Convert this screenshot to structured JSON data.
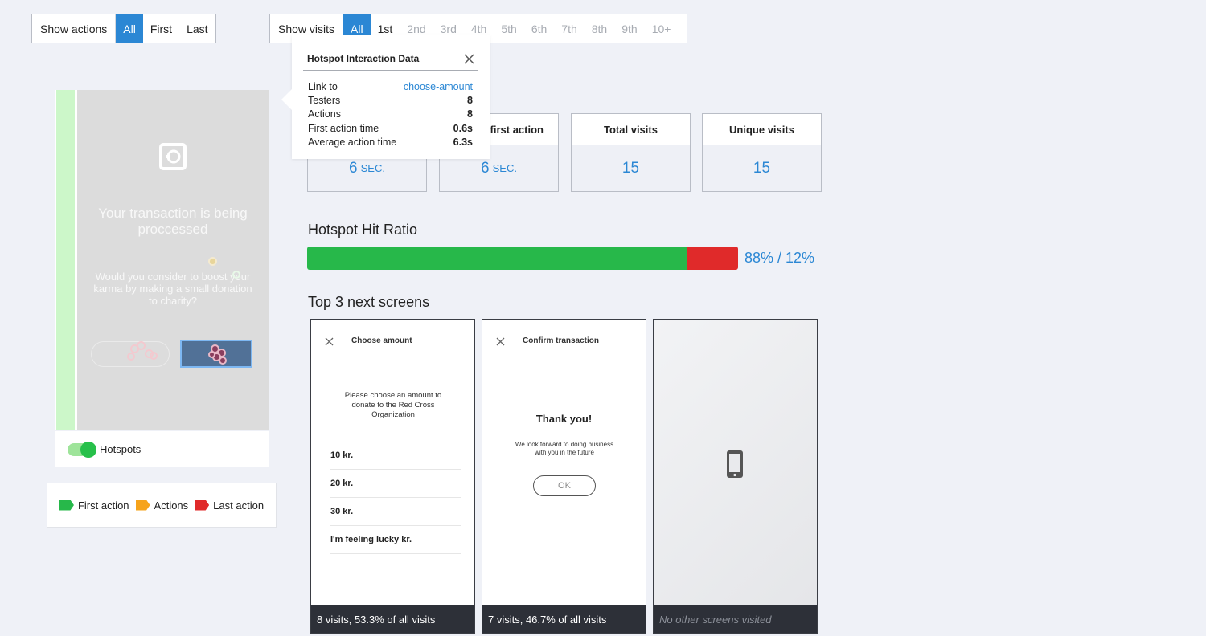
{
  "actions_filter": {
    "label": "Show actions",
    "options": [
      "All",
      "First",
      "Last"
    ],
    "selected": "All"
  },
  "visits_filter": {
    "label": "Show visits",
    "options": [
      "All",
      "1st",
      "2nd",
      "3rd",
      "4th",
      "5th",
      "6th",
      "7th",
      "8th",
      "9th",
      "10+"
    ],
    "selected": "All"
  },
  "screen": {
    "title": "Your transaction is being proccessed",
    "body": "Would you consider to boost your karma by making a small donation to charity?"
  },
  "hotspots_toggle": {
    "label": "Hotspots",
    "on": true
  },
  "legend": {
    "items": [
      {
        "label": "First action",
        "color": "#27b84a"
      },
      {
        "label": "Actions",
        "color": "#f6a31a"
      },
      {
        "label": "Last action",
        "color": "#e02a2a"
      }
    ]
  },
  "popover": {
    "title": "Hotspot Interaction Data",
    "rows": [
      {
        "label": "Link to",
        "value": "choose-amount"
      },
      {
        "label": "Testers",
        "value": "8"
      },
      {
        "label": "Actions",
        "value": "8"
      },
      {
        "label": "First action time",
        "value": "0.6s"
      },
      {
        "label": "Average action time",
        "value": "6.3s"
      }
    ]
  },
  "stats": [
    {
      "header": "",
      "value": "6",
      "unit": "SEC."
    },
    {
      "header": "first action",
      "value": "6",
      "unit": "SEC."
    },
    {
      "header": "Total visits",
      "value": "15",
      "unit": ""
    },
    {
      "header": "Unique visits",
      "value": "15",
      "unit": ""
    }
  ],
  "hit_ratio": {
    "title": "Hotspot Hit Ratio",
    "hit_percent": 88,
    "text": "88% / 12%",
    "hit_color": "#27b84a",
    "miss_color": "#e02a2a"
  },
  "next_screens": {
    "title": "Top 3 next screens",
    "cards": [
      {
        "screen_title": "Choose amount",
        "description": "Please choose an amount to donate to the Red Cross Organization",
        "options": [
          "10 kr.",
          "20 kr.",
          "30 kr.",
          "I'm feeling lucky kr."
        ],
        "footer": "8 visits, 53.3% of all visits"
      },
      {
        "screen_title": "Confirm transaction",
        "heading": "Thank you!",
        "subtext": "We look forward to doing business with you in the future",
        "button": "OK",
        "footer": "7 visits, 46.7% of all visits"
      },
      {
        "footer": "No other screens visited"
      }
    ]
  },
  "colors": {
    "accent": "#2b87d4",
    "dark_footer": "#2d3038"
  }
}
